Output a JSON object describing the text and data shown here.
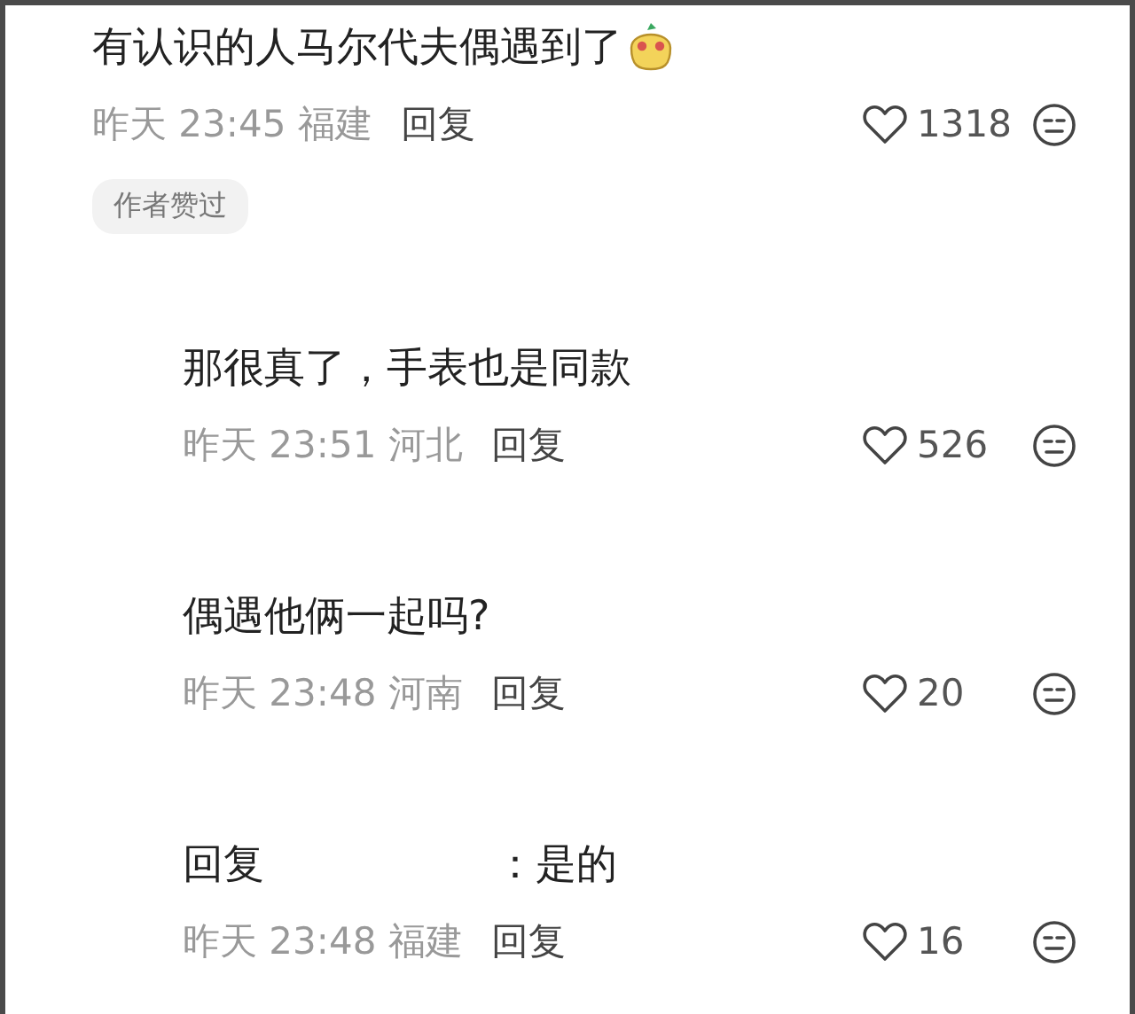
{
  "comment": {
    "text": "有认识的人马尔代夫偶遇到了",
    "time": "昨天 23:45",
    "location": "福建",
    "reply": "回复",
    "likes": "1318",
    "badge": "作者赞过"
  },
  "replies": [
    {
      "kind": "plain",
      "text": "那很真了，手表也是同款",
      "time": "昨天 23:51",
      "location": "河北",
      "reply": "回复",
      "likes": "526"
    },
    {
      "kind": "plain",
      "text": "偶遇他俩一起吗?",
      "time": "昨天 23:48",
      "location": "河南",
      "reply": "回复",
      "likes": "20"
    },
    {
      "kind": "reply_to",
      "prefix": "回复",
      "text": "：是的",
      "time": "昨天 23:48",
      "location": "福建",
      "reply": "回复",
      "likes": "16"
    }
  ]
}
